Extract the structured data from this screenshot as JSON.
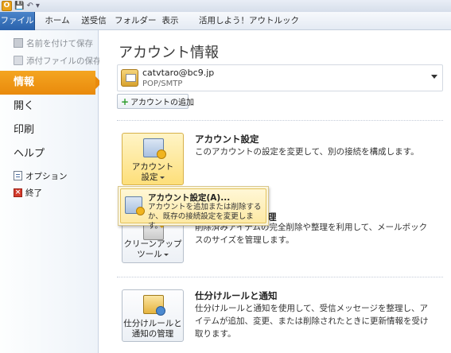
{
  "app": {
    "icon_letter": "O",
    "title_icon": "outlook-app-icon"
  },
  "qat": {
    "save": "💾",
    "undo": "↶",
    "more": "▾"
  },
  "ribbon": {
    "tabs": [
      {
        "label": "ファイル"
      },
      {
        "label": "ホーム"
      },
      {
        "label": "送受信"
      },
      {
        "label": "フォルダー"
      },
      {
        "label": "表示"
      },
      {
        "label": "活用しよう！アウトルック"
      }
    ]
  },
  "nav": {
    "save_as": "名前を付けて保存",
    "save_attachments": "添付ファイルの保存",
    "info": "情報",
    "open": "開く",
    "print": "印刷",
    "help": "ヘルプ",
    "options": "オプション",
    "exit": "終了"
  },
  "main": {
    "title": "アカウント情報",
    "account": {
      "email": "catvtaro@bc9.jp",
      "type": "POP/SMTP"
    },
    "add_account": "アカウントの追加",
    "sections": {
      "account_settings": {
        "button_line1": "アカウント",
        "button_line2": "設定",
        "title": "アカウント設定",
        "desc": "このアカウントの設定を変更して、別の接続を構成します。"
      },
      "cleanup": {
        "button_line1": "クリーンアップ",
        "button_line2": "ツール",
        "title": "理",
        "desc": "削除済みアイテムの完全削除や整理を利用して、メールボックスのサイズを管理します。"
      },
      "rules": {
        "button_line1": "仕分けルールと",
        "button_line2": "通知の管理",
        "title": "仕分けルールと通知",
        "desc": "仕分けルールと通知を使用して、受信メッセージを整理し、アイテムが追加、変更、または削除されたときに更新情報を受け取ります。"
      }
    },
    "popup": {
      "title": "アカウント設定(A)...",
      "desc": "アカウントを追加または削除するか、既存の接続設定を変更します。"
    }
  }
}
